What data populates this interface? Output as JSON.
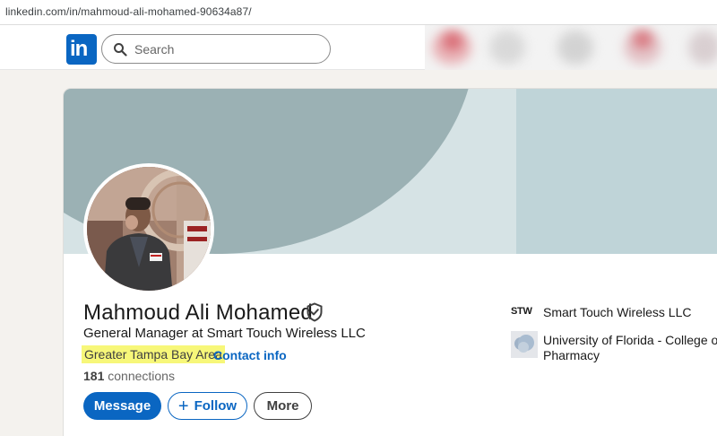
{
  "browser": {
    "url": "linkedin.com/in/mahmoud-ali-mohamed-90634a87/"
  },
  "nav": {
    "logo_text": "in",
    "search_placeholder": "Search"
  },
  "profile": {
    "name": "Mahmoud Ali Mohamed",
    "headline": "General Manager at Smart Touch Wireless LLC",
    "location": "Greater Tampa Bay Area",
    "separator": "·",
    "contact_label": "Contact info",
    "connections_count": "181",
    "connections_label": "connections"
  },
  "actions": {
    "message": "Message",
    "follow": "Follow",
    "follow_icon": "+",
    "more": "More"
  },
  "experience": {
    "company_logo_text": "STW",
    "company": "Smart Touch Wireless LLC",
    "school": "University of Florida - College of Pharmacy"
  },
  "colors": {
    "brand": "#0a66c2",
    "highlight": "#f7f779"
  },
  "icons": [
    "search-icon",
    "verified-shield-icon",
    "plus-icon"
  ]
}
